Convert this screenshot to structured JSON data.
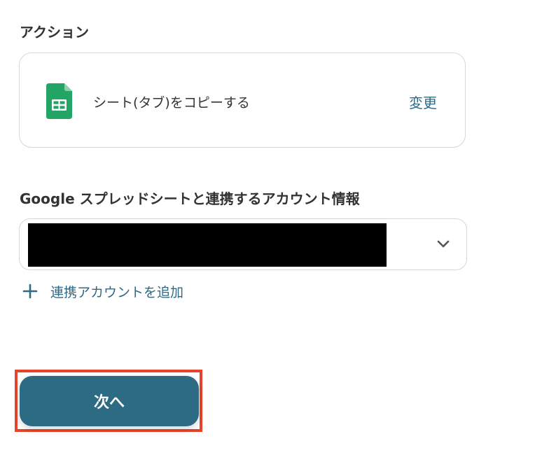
{
  "action_section": {
    "label": "アクション",
    "action_name": "シート(タブ)をコピーする",
    "change_label": "変更",
    "icon": "google-sheets-icon"
  },
  "account_section": {
    "label": "Google スプレッドシートと連携するアカウント情報",
    "selected_value": "",
    "add_account_label": "連携アカウントを追加"
  },
  "footer": {
    "next_label": "次へ"
  },
  "colors": {
    "accent": "#2d6b84",
    "highlight": "#e8432a",
    "sheets_green": "#23a566"
  }
}
